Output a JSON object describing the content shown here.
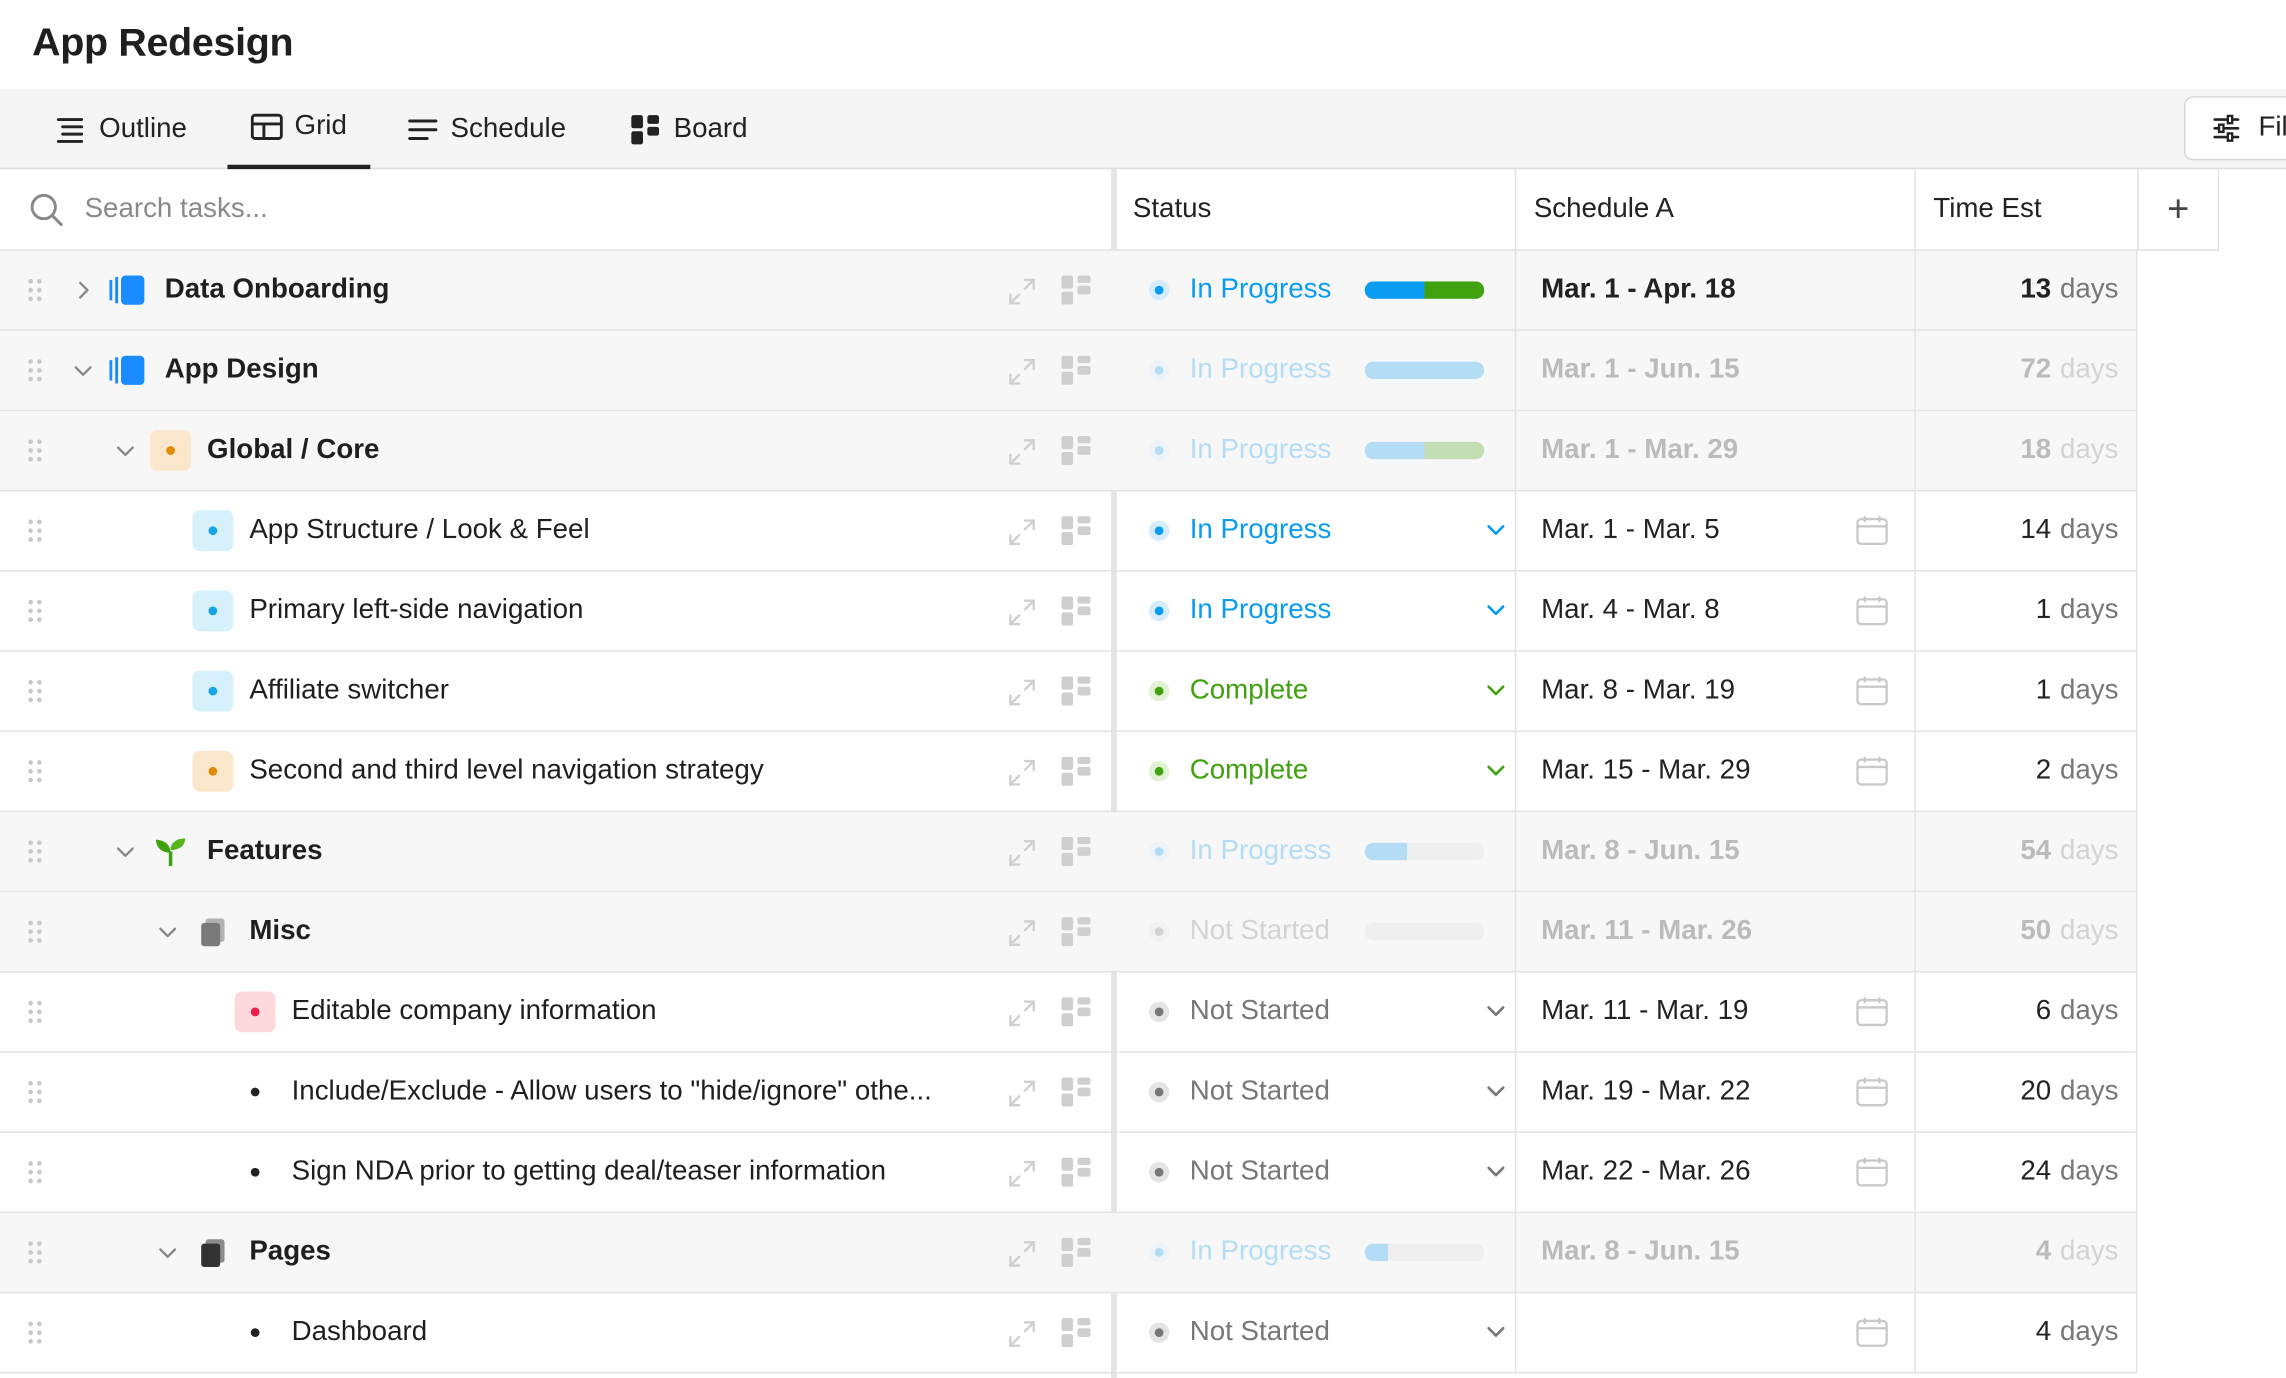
{
  "app": {
    "title": "App Redesign"
  },
  "tabs": [
    {
      "label": "Outline",
      "icon": "outline-icon"
    },
    {
      "label": "Grid",
      "icon": "grid-icon",
      "active": true
    },
    {
      "label": "Schedule",
      "icon": "schedule-icon"
    },
    {
      "label": "Board",
      "icon": "board-icon"
    }
  ],
  "filter": {
    "label": "Fil"
  },
  "search": {
    "placeholder": "Search tasks..."
  },
  "columns": {
    "status": "Status",
    "schedule": "Schedule A",
    "time": "Time Est",
    "add": "+"
  },
  "colors": {
    "blue": "#0a9cf0",
    "green": "#3fa10e",
    "gray": "#777777",
    "accent_blue": "#1a8cff"
  },
  "rows": [
    {
      "name": "Data Onboarding",
      "status": "In Progress",
      "schedule": "Mar. 1 - Apr. 18",
      "time_num": "13",
      "time_unit": "days",
      "progress": {
        "blue": 0.5,
        "green": 0.5
      }
    },
    {
      "name": "App Design",
      "status": "In Progress",
      "schedule": "Mar. 1 - Jun. 15",
      "time_num": "72",
      "time_unit": "days",
      "progress": {
        "blue": 1.0,
        "green": 0
      }
    },
    {
      "name": "Global / Core",
      "status": "In Progress",
      "schedule": "Mar. 1 - Mar. 29",
      "time_num": "18",
      "time_unit": "days",
      "progress": {
        "blue": 0.5,
        "green": 0.5
      }
    },
    {
      "name": "App Structure / Look & Feel",
      "status": "In Progress",
      "schedule": "Mar. 1 - Mar. 5",
      "time_num": "14",
      "time_unit": "days"
    },
    {
      "name": "Primary left-side navigation",
      "status": "In Progress",
      "schedule": "Mar. 4 - Mar. 8",
      "time_num": "1",
      "time_unit": "days"
    },
    {
      "name": "Affiliate switcher",
      "status": "Complete",
      "schedule": "Mar. 8 - Mar. 19",
      "time_num": "1",
      "time_unit": "days"
    },
    {
      "name": "Second and third level navigation strategy",
      "status": "Complete",
      "schedule": "Mar. 15 - Mar. 29",
      "time_num": "2",
      "time_unit": "days"
    },
    {
      "name": "Features",
      "status": "In Progress",
      "schedule": "Mar. 8 - Jun. 15",
      "time_num": "54",
      "time_unit": "days",
      "progress": {
        "blue": 0.35,
        "green": 0
      }
    },
    {
      "name": "Misc",
      "status": "Not Started",
      "schedule": "Mar. 11 - Mar. 26",
      "time_num": "50",
      "time_unit": "days",
      "progress": {
        "blue": 0,
        "green": 0
      }
    },
    {
      "name": "Editable company information",
      "status": "Not Started",
      "schedule": "Mar. 11 - Mar. 19",
      "time_num": "6",
      "time_unit": "days"
    },
    {
      "name": "Include/Exclude - Allow users to \"hide/ignore\" othe...",
      "status": "Not Started",
      "schedule": "Mar. 19 - Mar. 22",
      "time_num": "20",
      "time_unit": "days"
    },
    {
      "name": "Sign NDA prior to getting deal/teaser information",
      "status": "Not Started",
      "schedule": "Mar. 22 - Mar. 26",
      "time_num": "24",
      "time_unit": "days"
    },
    {
      "name": "Pages",
      "status": "In Progress",
      "schedule": "Mar. 8 - Jun. 15",
      "time_num": "4",
      "time_unit": "days",
      "progress": {
        "blue": 0.2,
        "green": 0
      }
    },
    {
      "name": "Dashboard",
      "status": "Not Started",
      "schedule": "",
      "time_num": "4",
      "time_unit": "days"
    }
  ]
}
